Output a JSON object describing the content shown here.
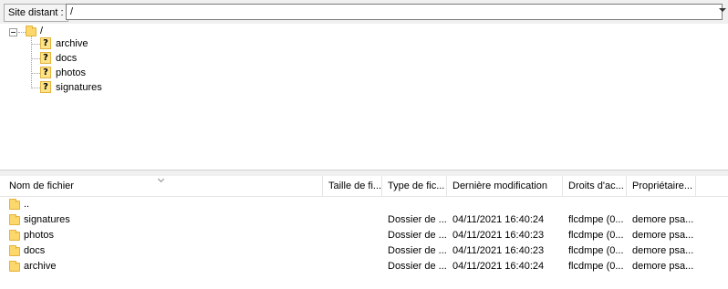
{
  "remote_site": {
    "label": "Site distant :",
    "path": "/"
  },
  "tree": {
    "root": "/",
    "children": [
      "archive",
      "docs",
      "photos",
      "signatures"
    ],
    "unknown_icon_glyph": "?",
    "folder_icon": "folder-icon",
    "unknown_icon": "question-folder-icon"
  },
  "file_list": {
    "columns": [
      "Nom de fichier",
      "Taille de fi...",
      "Type de fic...",
      "Dernière modification",
      "Droits d'ac...",
      "Propriétaire..."
    ],
    "rows": [
      {
        "name": "..",
        "size": "",
        "type": "",
        "modified": "",
        "rights": "",
        "owner": ""
      },
      {
        "name": "signatures",
        "size": "",
        "type": "Dossier de ...",
        "modified": "04/11/2021 16:40:24",
        "rights": "flcdmpe (0...",
        "owner": "demore psa..."
      },
      {
        "name": "photos",
        "size": "",
        "type": "Dossier de ...",
        "modified": "04/11/2021 16:40:23",
        "rights": "flcdmpe (0...",
        "owner": "demore psa..."
      },
      {
        "name": "docs",
        "size": "",
        "type": "Dossier de ...",
        "modified": "04/11/2021 16:40:23",
        "rights": "flcdmpe (0...",
        "owner": "demore psa..."
      },
      {
        "name": "archive",
        "size": "",
        "type": "Dossier de ...",
        "modified": "04/11/2021 16:40:24",
        "rights": "flcdmpe (0...",
        "owner": "demore psa..."
      }
    ]
  },
  "colors": {
    "folder_fill": "#fcd76b",
    "folder_border": "#e4b23b",
    "pane_bg": "#ffffff",
    "bar_bg": "#f0f0f0"
  }
}
